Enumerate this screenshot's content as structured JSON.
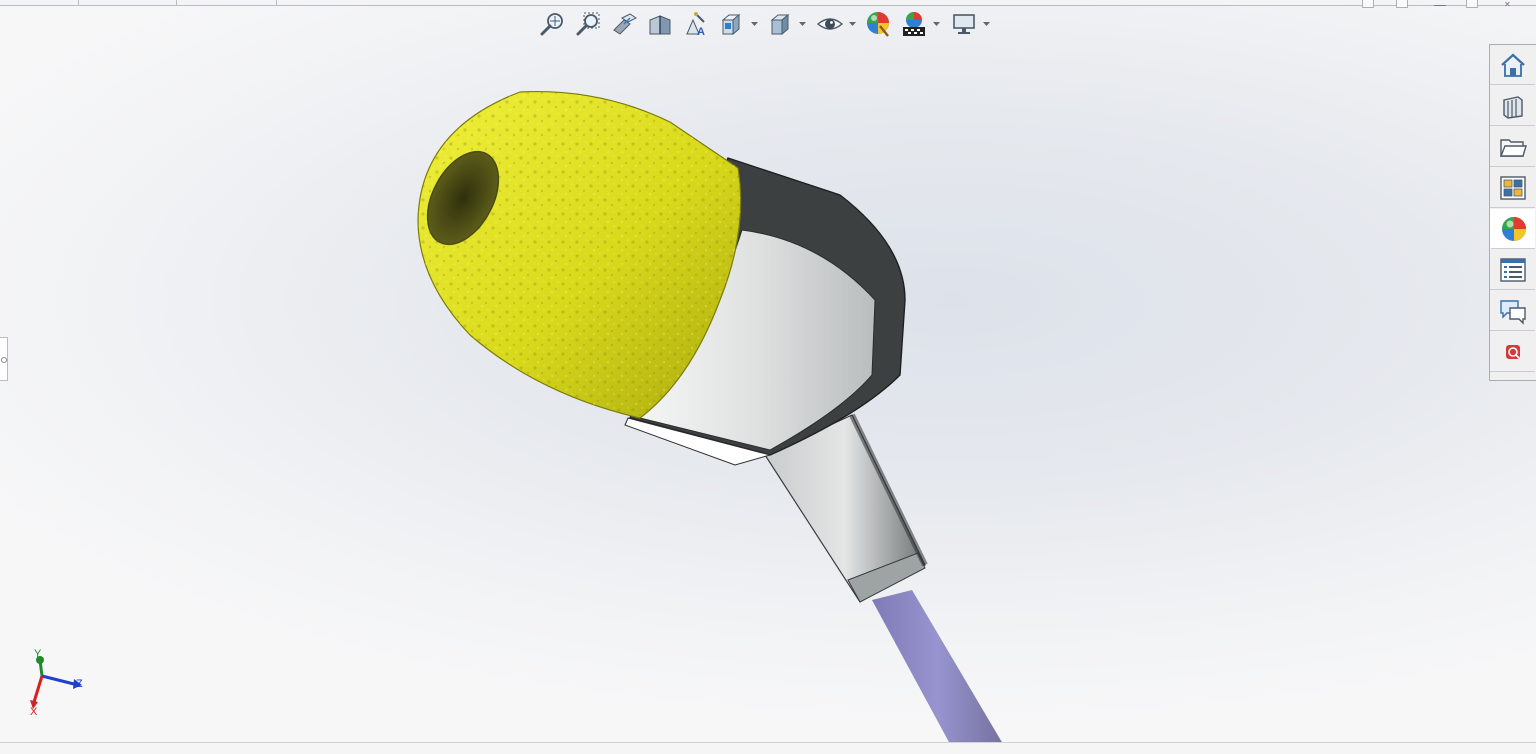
{
  "toolbar": {
    "buttons": [
      {
        "name": "zoom-to-fit",
        "icon": "zoom-fit-icon"
      },
      {
        "name": "zoom-to-area",
        "icon": "zoom-area-icon"
      },
      {
        "name": "previous-view",
        "icon": "previous-view-icon"
      },
      {
        "name": "section-view",
        "icon": "section-view-icon"
      },
      {
        "name": "dynamic-annotation-views",
        "icon": "annotation-view-icon"
      },
      {
        "name": "view-orientation",
        "icon": "view-orientation-icon"
      },
      {
        "name": "display-style",
        "icon": "display-style-icon"
      },
      {
        "name": "hide-show-items",
        "icon": "eye-icon"
      },
      {
        "name": "edit-appearance",
        "icon": "appearance-sphere-icon"
      },
      {
        "name": "apply-scene",
        "icon": "scene-icon"
      },
      {
        "name": "view-settings",
        "icon": "monitor-icon"
      }
    ]
  },
  "task_pane": {
    "tabs": [
      {
        "name": "solidworks-resources",
        "icon": "home-icon"
      },
      {
        "name": "design-library",
        "icon": "design-library-icon"
      },
      {
        "name": "file-explorer",
        "icon": "folder-icon"
      },
      {
        "name": "view-palette",
        "icon": "view-palette-icon"
      },
      {
        "name": "appearances-scenes-decals",
        "icon": "appearance-sphere-icon",
        "active": true
      },
      {
        "name": "custom-properties",
        "icon": "properties-list-icon"
      },
      {
        "name": "solidworks-forum",
        "icon": "forum-icon"
      },
      {
        "name": "solidworks-labs",
        "icon": "labs-icon"
      }
    ]
  },
  "triad": {
    "y_label": "Y",
    "z_label": "Z",
    "x_label": "X",
    "colors": {
      "x": "#d42020",
      "y": "#1f8a2a",
      "z": "#1f3fd0"
    }
  },
  "model": {
    "colors": {
      "ear_tip": "#dede1a",
      "shell_dark": "#3c4040",
      "shell_light": "#e4e6e6",
      "cable": "#8f8cc6"
    }
  }
}
